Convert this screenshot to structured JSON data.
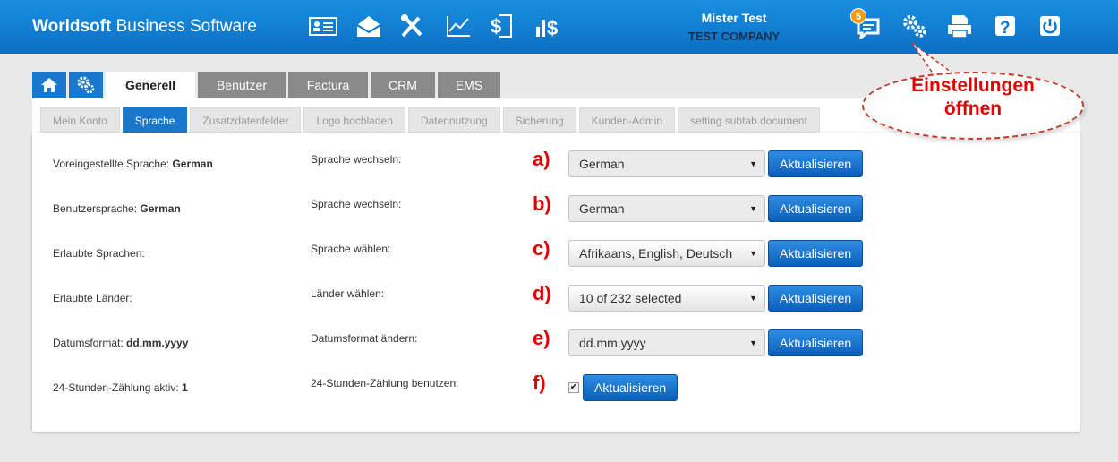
{
  "app": {
    "brand_bold": "Worldsoft",
    "brand_rest": "Business Software"
  },
  "user": {
    "name": "Mister Test",
    "company": "TEST COMPANY"
  },
  "notifications": {
    "count": "5"
  },
  "main_tabs": [
    "Generell",
    "Benutzer",
    "Factura",
    "CRM",
    "EMS"
  ],
  "sub_tabs": [
    "Mein Konto",
    "Sprache",
    "Zusatzdatenfelder",
    "Logo hochladen",
    "Datennutzung",
    "Sicherung",
    "Kunden-Admin",
    "setting.subtab.document"
  ],
  "callout": {
    "line1": "Einstellungen",
    "line2": "öffnen"
  },
  "rows": [
    {
      "label": "Voreingestellte Sprache:",
      "value": "German",
      "action": "Sprache wechseln:",
      "marker": "a)",
      "select": "German",
      "button": "Aktualisieren"
    },
    {
      "label": "Benutzersprache:",
      "value": "German",
      "action": "Sprache wechseln:",
      "marker": "b)",
      "select": "German",
      "button": "Aktualisieren"
    },
    {
      "label": "Erlaubte Sprachen:",
      "value": "",
      "action": "Sprache wählen:",
      "marker": "c)",
      "select": "Afrikaans, English, Deutsch",
      "button": "Aktualisieren"
    },
    {
      "label": "Erlaubte Länder:",
      "value": "",
      "action": "Länder wählen:",
      "marker": "d)",
      "select": "10 of 232 selected",
      "button": "Aktualisieren"
    },
    {
      "label": "Datumsformat:",
      "value": "dd.mm.yyyy",
      "action": "Datumsformat ändern:",
      "marker": "e)",
      "select": "dd.mm.yyyy",
      "button": "Aktualisieren"
    },
    {
      "label": "24-Stunden-Zählung aktiv:",
      "value": "1",
      "action": "24-Stunden-Zählung benutzen:",
      "marker": "f)",
      "checkbox": "checked",
      "button": "Aktualisieren"
    }
  ],
  "colors": {
    "accent": "#1a78cc",
    "marker": "#e00000",
    "topbar": "#1a8fe0"
  },
  "icons": [
    "contact-card-icon",
    "mail-icon",
    "tools-icon",
    "chart-icon",
    "invoice-icon",
    "revenue-icon",
    "chat-icon",
    "settings-icon",
    "print-icon",
    "help-icon",
    "power-icon",
    "home-icon",
    "gears-icon"
  ]
}
